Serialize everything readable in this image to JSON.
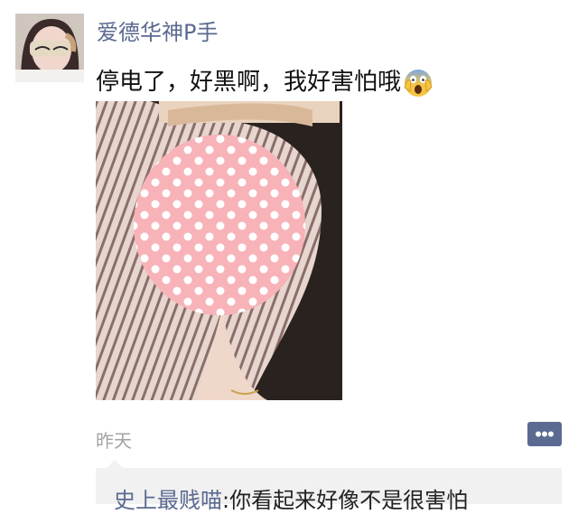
{
  "post": {
    "username": "爱德华神P手",
    "text": "停电了，好黑啊，我好害怕哦",
    "emoji": "screaming-face-emoji",
    "timestamp": "昨天"
  },
  "comment": {
    "author": "史上最贱喵",
    "separator": ":",
    "text": "你看起来好像不是很害怕"
  },
  "colors": {
    "link": "#5b6a91",
    "timestamp": "#a3a3a3",
    "comment_bg": "#f1f1f1"
  },
  "icons": {
    "more": "ellipsis-comment-icon"
  }
}
